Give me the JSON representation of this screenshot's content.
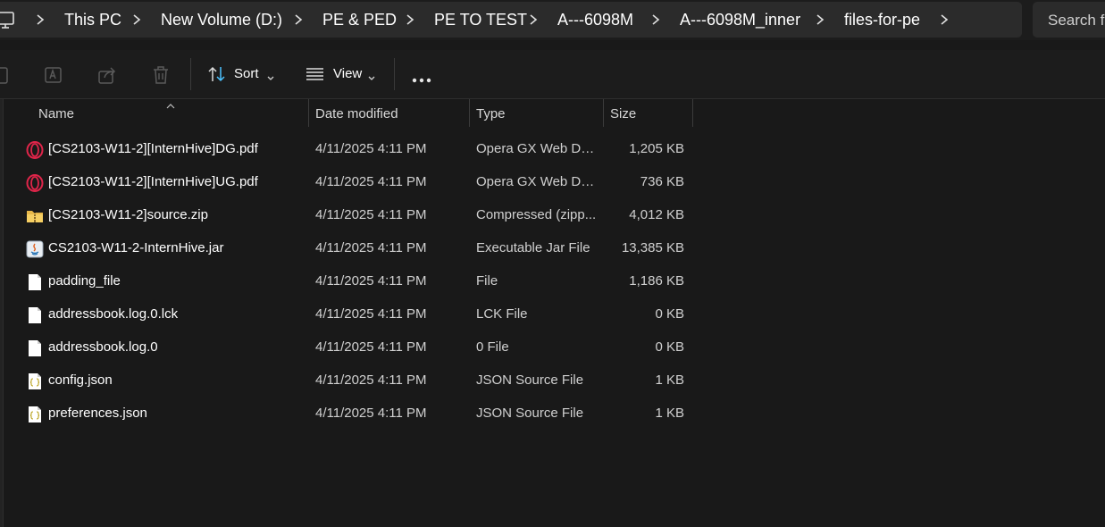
{
  "breadcrumb": {
    "items": [
      "This PC",
      "New Volume (D:)",
      "PE & PED",
      "PE TO TEST",
      "A---6098M",
      "A---6098M_inner",
      "files-for-pe"
    ]
  },
  "search": {
    "placeholder": "Search fi"
  },
  "toolbar": {
    "sort_label": "Sort",
    "view_label": "View"
  },
  "columns": {
    "name": "Name",
    "date": "Date modified",
    "type": "Type",
    "size": "Size"
  },
  "files": [
    {
      "name": "[CS2103-W11-2][InternHive]DG.pdf",
      "date": "4/11/2025 4:11 PM",
      "type": "Opera GX Web Do...",
      "size": "1,205 KB",
      "icon": "opera-pdf-icon"
    },
    {
      "name": "[CS2103-W11-2][InternHive]UG.pdf",
      "date": "4/11/2025 4:11 PM",
      "type": "Opera GX Web Do...",
      "size": "736 KB",
      "icon": "opera-pdf-icon"
    },
    {
      "name": "[CS2103-W11-2]source.zip",
      "date": "4/11/2025 4:11 PM",
      "type": "Compressed (zipp...",
      "size": "4,012 KB",
      "icon": "zip-folder-icon"
    },
    {
      "name": "CS2103-W11-2-InternHive.jar",
      "date": "4/11/2025 4:11 PM",
      "type": "Executable Jar File",
      "size": "13,385 KB",
      "icon": "java-jar-icon"
    },
    {
      "name": "padding_file",
      "date": "4/11/2025 4:11 PM",
      "type": "File",
      "size": "1,186 KB",
      "icon": "blank-file-icon"
    },
    {
      "name": "addressbook.log.0.lck",
      "date": "4/11/2025 4:11 PM",
      "type": "LCK File",
      "size": "0 KB",
      "icon": "blank-file-icon"
    },
    {
      "name": "addressbook.log.0",
      "date": "4/11/2025 4:11 PM",
      "type": "0 File",
      "size": "0 KB",
      "icon": "blank-file-icon"
    },
    {
      "name": "config.json",
      "date": "4/11/2025 4:11 PM",
      "type": "JSON Source File",
      "size": "1 KB",
      "icon": "json-file-icon"
    },
    {
      "name": "preferences.json",
      "date": "4/11/2025 4:11 PM",
      "type": "JSON Source File",
      "size": "1 KB",
      "icon": "json-file-icon"
    }
  ]
}
